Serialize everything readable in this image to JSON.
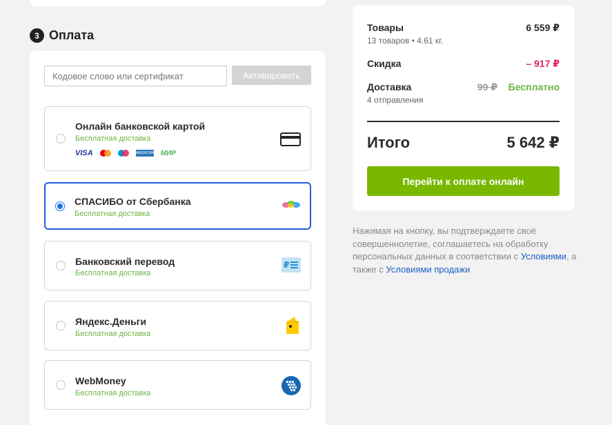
{
  "section": {
    "step": "3",
    "title": "Оплата"
  },
  "promo": {
    "placeholder": "Кодовое слово или сертификат",
    "button": "Активировать"
  },
  "payment_options": [
    {
      "title": "Онлайн банковской картой",
      "subtitle": "Бесплатная доставка",
      "icon": "credit-card-icon",
      "selected": false,
      "brands": {
        "visa": "VISA",
        "amex": "AMERICAN EXPRESS",
        "mir": "МИР"
      }
    },
    {
      "title": "СПАСИБО от Сбербанка",
      "subtitle": "Бесплатная доставка",
      "icon": "spasibo-logo-icon",
      "selected": true
    },
    {
      "title": "Банковский перевод",
      "subtitle": "Бесплатная доставка",
      "icon": "bank-transfer-icon",
      "selected": false
    },
    {
      "title": "Яндекс.Деньги",
      "subtitle": "Бесплатная доставка",
      "icon": "yandex-money-icon",
      "selected": false
    },
    {
      "title": "WebMoney",
      "subtitle": "Бесплатная доставка",
      "icon": "webmoney-icon",
      "selected": false
    }
  ],
  "summary": {
    "goods_label": "Товары",
    "goods_sub": "13 товаров • 4.61 кг.",
    "goods_value": "6 559 ₽",
    "discount_label": "Скидка",
    "discount_value": "– 917 ₽",
    "delivery_label": "Доставка",
    "delivery_sub": "4 отправления",
    "delivery_old": "99 ₽",
    "delivery_value": "Бесплатно",
    "total_label": "Итого",
    "total_value": "5 642 ₽",
    "pay_button": "Перейти к оплате онлайн"
  },
  "terms": {
    "text1": "Нажимая на кнопку, вы подтверждаете своё совершеннолетие, соглашаетесь на обработку персональных данных в соответствии с ",
    "link1": "Условиями",
    "text2": ", а также с ",
    "link2": "Условиями продажи"
  },
  "colors": {
    "accent_green": "#7ab800",
    "free_green": "#6cb33f",
    "discount_red": "#e0245e",
    "selected_blue": "#1f5fd6",
    "link_blue": "#1a5dc8"
  }
}
